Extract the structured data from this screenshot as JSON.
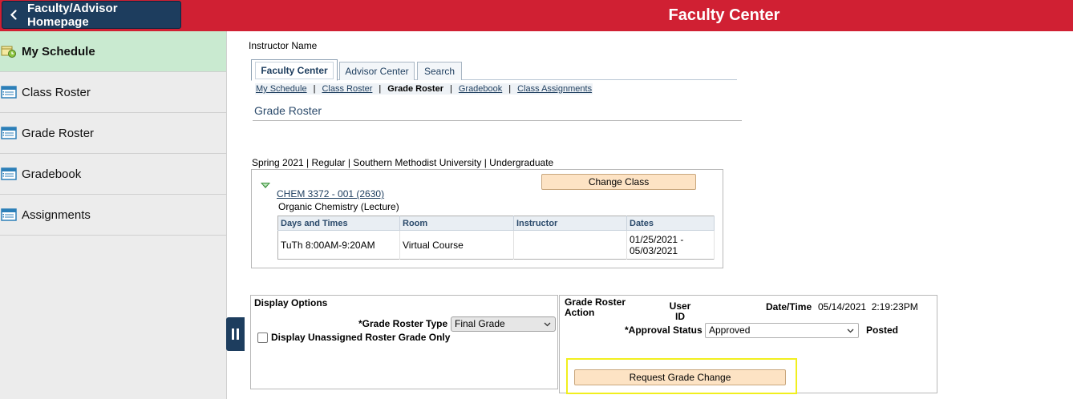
{
  "header": {
    "home_button_label": "Faculty/Advisor Homepage",
    "app_title": "Faculty Center",
    "bar_color": "#d02033"
  },
  "sidebar": {
    "items": [
      {
        "label": "My Schedule",
        "icon": "schedule-icon",
        "active": true
      },
      {
        "label": "Class Roster",
        "icon": "roster-icon",
        "active": false
      },
      {
        "label": "Grade Roster",
        "icon": "roster-icon",
        "active": false
      },
      {
        "label": "Gradebook",
        "icon": "roster-icon",
        "active": false
      },
      {
        "label": "Assignments",
        "icon": "roster-icon",
        "active": false
      }
    ]
  },
  "main": {
    "instructor_name_label": "Instructor Name",
    "tabs": [
      {
        "label": "Faculty Center",
        "active": true
      },
      {
        "label": "Advisor Center",
        "active": false
      },
      {
        "label": "Search",
        "active": false
      }
    ],
    "subnav": [
      {
        "label": "My Schedule",
        "current": false
      },
      {
        "label": "Class Roster",
        "current": false
      },
      {
        "label": "Grade Roster",
        "current": true
      },
      {
        "label": "Gradebook",
        "current": false
      },
      {
        "label": "Class Assignments",
        "current": false
      }
    ],
    "subnav_separator": "|",
    "page_heading": "Grade Roster",
    "term_line": "Spring 2021 | Regular | Southern Methodist University | Undergraduate",
    "class": {
      "change_class_label": "Change Class",
      "class_link": "CHEM 3372 - 001 (2630)",
      "class_title": "Organic Chemistry (Lecture)",
      "table": {
        "headers": [
          "Days and Times",
          "Room",
          "Instructor",
          "Dates"
        ],
        "rows": [
          {
            "days_times": "TuTh 8:00AM-9:20AM",
            "room": "Virtual Course",
            "instructor": "",
            "dates_start": "01/25/2021 -",
            "dates_end": "05/03/2021"
          }
        ]
      }
    },
    "display_options": {
      "title": "Display Options",
      "grade_roster_type_label": "*Grade Roster Type",
      "grade_roster_type_value": "Final Grade",
      "unassigned_label": "Display Unassigned Roster Grade Only",
      "unassigned_checked": false
    },
    "grade_roster_action": {
      "title_line1": "Grade Roster",
      "title_line2": "Action",
      "user_id_line1": "User",
      "user_id_line2": "ID",
      "datetime_label": "Date/Time",
      "datetime_value": "05/14/2021  2:19:23PM",
      "approval_status_label": "*Approval Status",
      "approval_status_value": "Approved",
      "posted_label": "Posted",
      "request_grade_change_label": "Request Grade Change"
    }
  }
}
